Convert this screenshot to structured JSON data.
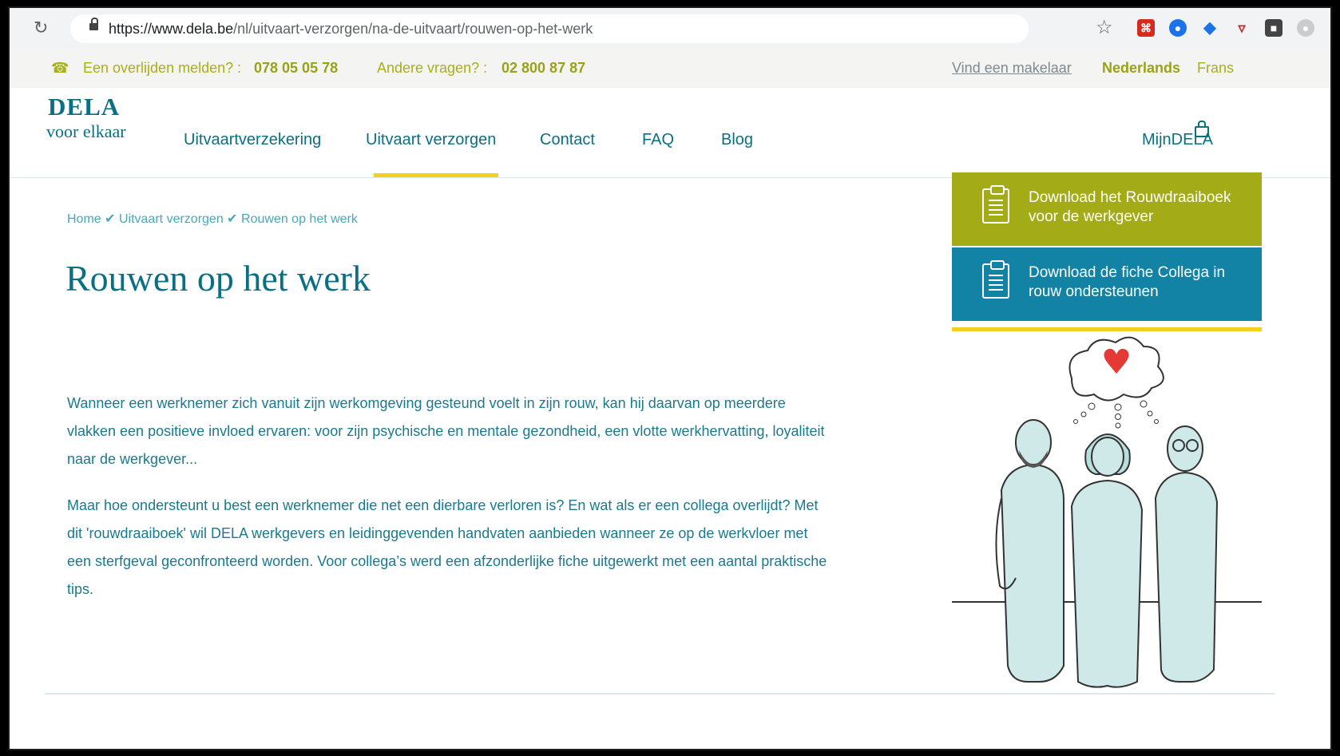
{
  "browser": {
    "url_host": "https://www.dela.be",
    "url_path": "/nl/uitvaart-verzorgen/na-de-uitvaart/rouwen-op-het-werk"
  },
  "infobar": {
    "report_label": "Een overlijden melden? :",
    "report_phone": "078 05 05 78",
    "other_label": "Andere vragen? :",
    "other_phone": "02 800 87 87",
    "broker_link": "Vind een makelaar",
    "lang_active": "Nederlands",
    "lang_other": "Frans"
  },
  "header": {
    "logo_main": "DELA",
    "logo_sub": "voor elkaar",
    "nav": [
      "Uitvaartverzekering",
      "Uitvaart verzorgen",
      "Contact",
      "FAQ",
      "Blog"
    ],
    "active_nav": "Uitvaart verzorgen",
    "account_label": "MijnDELA"
  },
  "breadcrumb": [
    "Home",
    "Uitvaart verzorgen",
    "Rouwen op het werk"
  ],
  "page_title": "Rouwen op het werk",
  "paragraphs": [
    "Wanneer een werknemer zich vanuit zijn werkomgeving gesteund voelt in zijn rouw, kan hij daarvan op meerdere vlakken een positieve invloed ervaren: voor zijn psychische en mentale gezondheid, een vlotte werkhervatting, loyaliteit naar de werkgever...",
    "Maar hoe ondersteunt u best een werknemer die net een dierbare verloren is? En wat als er een collega overlijdt? Met dit 'rouwdraaiboek' wil DELA werkgevers en leidinggevenden handvaten aanbieden wanneer ze op de werkvloer met een sterfgeval geconfronteerd worden. Voor collega’s werd een afzonderlijke fiche uitgewerkt met een aantal praktische tips."
  ],
  "downloads": [
    {
      "label": "Download het Rouwdraaiboek voor de werkgever",
      "color": "#a3ab17"
    },
    {
      "label": "Download de fiche Collega in rouw ondersteunen",
      "color": "#1383a5"
    }
  ],
  "colors": {
    "brand_teal": "#0b6f84",
    "accent_olive": "#a7b017",
    "accent_yellow": "#f2d01f"
  }
}
